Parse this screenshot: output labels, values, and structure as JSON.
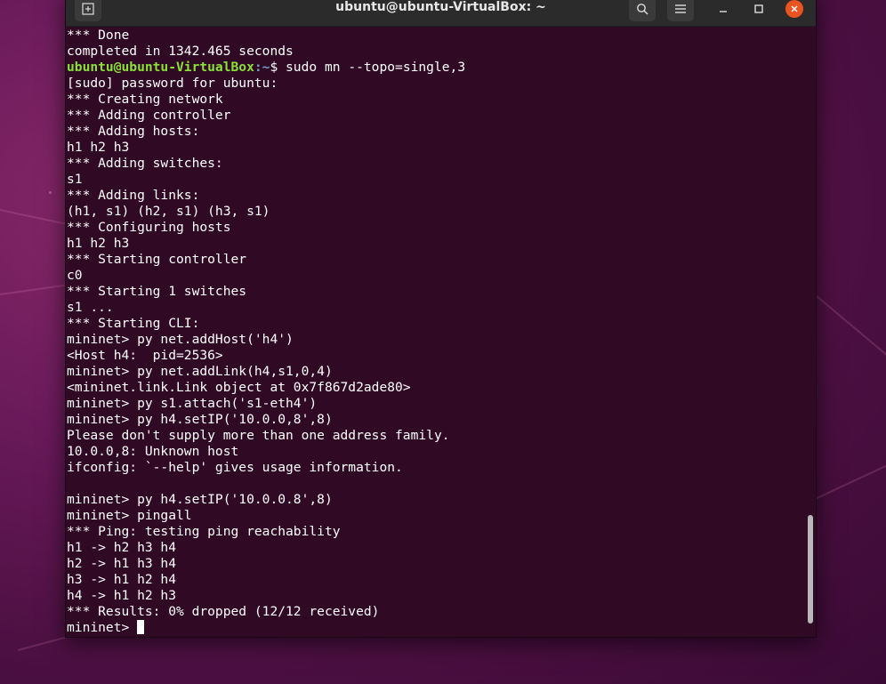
{
  "window": {
    "title": "ubuntu@ubuntu-VirtualBox: ~"
  },
  "terminal": {
    "prompt_user": "ubuntu@ubuntu-VirtualBox",
    "prompt_path": ":~",
    "prompt_sudo_command": "$ sudo mn --topo=single,3",
    "lines": [
      "*** Done",
      "completed in 1342.465 seconds",
      "__PROMPT__",
      "[sudo] password for ubuntu:",
      "*** Creating network",
      "*** Adding controller",
      "*** Adding hosts:",
      "h1 h2 h3",
      "*** Adding switches:",
      "s1",
      "*** Adding links:",
      "(h1, s1) (h2, s1) (h3, s1)",
      "*** Configuring hosts",
      "h1 h2 h3",
      "*** Starting controller",
      "c0",
      "*** Starting 1 switches",
      "s1 ...",
      "*** Starting CLI:",
      "mininet> py net.addHost('h4')",
      "<Host h4:  pid=2536>",
      "mininet> py net.addLink(h4,s1,0,4)",
      "<mininet.link.Link object at 0x7f867d2ade80>",
      "mininet> py s1.attach('s1-eth4')",
      "mininet> py h4.setIP('10.0.0,8',8)",
      "Please don't supply more than one address family.",
      "10.0.0,8: Unknown host",
      "ifconfig: `--help' gives usage information.",
      "",
      "mininet> py h4.setIP('10.0.0.8',8)",
      "mininet> pingall",
      "*** Ping: testing ping reachability",
      "h1 -> h2 h3 h4",
      "h2 -> h1 h3 h4",
      "h3 -> h1 h2 h4",
      "h4 -> h1 h2 h3",
      "*** Results: 0% dropped (12/12 received)"
    ],
    "final_prompt": "mininet> "
  },
  "icons": {
    "new_tab": "new-tab-icon",
    "search": "search-icon",
    "menu": "hamburger-menu-icon",
    "minimize": "minimize-icon",
    "maximize": "maximize-icon",
    "close": "close-icon"
  },
  "colors": {
    "terminal_bg": "#300a24",
    "prompt_user": "#8ae234",
    "prompt_path": "#729fcf",
    "close_button": "#e95420"
  }
}
